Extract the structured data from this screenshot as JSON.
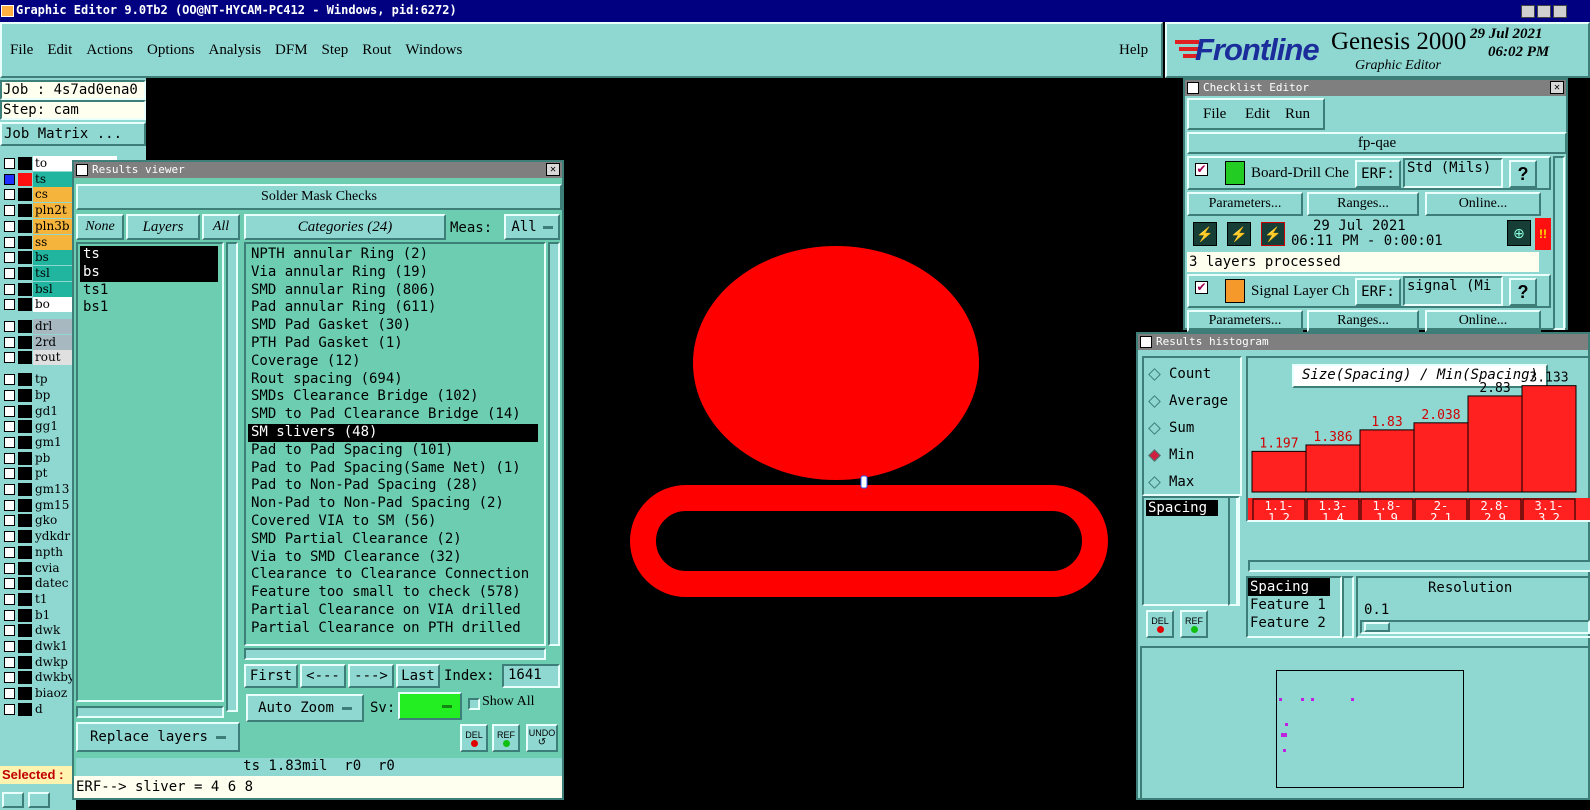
{
  "window_title": "Graphic Editor 9.0Tb2 (OO@NT-HYCAM-PC412 - Windows, pid:6272)",
  "menu": {
    "items": [
      "File",
      "Edit",
      "Actions",
      "Options",
      "Analysis",
      "DFM",
      "Step",
      "Rout",
      "Windows"
    ],
    "help": "Help"
  },
  "brand": {
    "logo": "Frontline",
    "product": "Genesis 2000",
    "subtitle": "Graphic Editor",
    "date": "29 Jul 2021",
    "time": "06:02 PM"
  },
  "job": {
    "job_label": "Job : 4s7ad0ena0",
    "step_label": "Step: cam",
    "matrix_button": "Job Matrix ..."
  },
  "layers": [
    {
      "name": "to",
      "color": "#ffffff"
    },
    {
      "name": "ts",
      "color": "#21b59f"
    },
    {
      "name": "cs",
      "color": "#f5b53c"
    },
    {
      "name": "pln2t",
      "color": "#f5b53c"
    },
    {
      "name": "pln3b",
      "color": "#f5b53c"
    },
    {
      "name": "ss",
      "color": "#f5b53c"
    },
    {
      "name": "bs",
      "color": "#21b59f"
    },
    {
      "name": "tsl",
      "color": "#21b59f"
    },
    {
      "name": "bsl",
      "color": "#21b59f"
    },
    {
      "name": "bo",
      "color": "#ffffff"
    },
    {
      "name": "drl",
      "color": "#a8b8c0"
    },
    {
      "name": "2rd",
      "color": "#a8b8c0"
    },
    {
      "name": "rout",
      "color": "#e0e0e0"
    },
    {
      "name": "tp",
      "color": "#8fd8d2"
    },
    {
      "name": "bp",
      "color": "#8fd8d2"
    },
    {
      "name": "gd1",
      "color": "#8fd8d2"
    },
    {
      "name": "gg1",
      "color": "#8fd8d2"
    },
    {
      "name": "gm1",
      "color": "#8fd8d2"
    },
    {
      "name": "pb",
      "color": "#8fd8d2"
    },
    {
      "name": "pt",
      "color": "#8fd8d2"
    },
    {
      "name": "gm13",
      "color": "#8fd8d2"
    },
    {
      "name": "gm15",
      "color": "#8fd8d2"
    },
    {
      "name": "gko",
      "color": "#8fd8d2"
    },
    {
      "name": "ydkdr",
      "color": "#8fd8d2"
    },
    {
      "name": "npth",
      "color": "#8fd8d2"
    },
    {
      "name": "cvia",
      "color": "#8fd8d2"
    },
    {
      "name": "datec",
      "color": "#8fd8d2"
    },
    {
      "name": "t1",
      "color": "#8fd8d2"
    },
    {
      "name": "b1",
      "color": "#8fd8d2"
    },
    {
      "name": "dwk",
      "color": "#8fd8d2"
    },
    {
      "name": "dwk1",
      "color": "#8fd8d2"
    },
    {
      "name": "dwkp",
      "color": "#8fd8d2"
    },
    {
      "name": "dwkby",
      "color": "#8fd8d2"
    },
    {
      "name": "biaoz",
      "color": "#8fd8d2"
    },
    {
      "name": "d",
      "color": "#8fd8d2"
    }
  ],
  "selected_label": "Selected :",
  "results_viewer": {
    "title": "Results viewer",
    "header": "Solder Mask Checks",
    "none_btn": "None",
    "layers_label": "Layers",
    "all_btn": "All",
    "layer_list": [
      "ts",
      "bs",
      "ts1",
      "bs1"
    ],
    "selected_layers": [
      0,
      1
    ],
    "categories_label": "Categories (24)",
    "meas_label": "Meas:",
    "meas_value": "All",
    "categories": [
      "NPTH annular Ring (2)",
      "Via annular Ring (19)",
      "SMD annular Ring (806)",
      "Pad annular Ring (611)",
      "SMD Pad Gasket (30)",
      "PTH Pad Gasket (1)",
      "Coverage (12)",
      "Rout spacing (694)",
      "SMDs Clearance Bridge (102)",
      "SMD to Pad Clearance Bridge (14)",
      "SM slivers (48)",
      "Pad to Pad Spacing (101)",
      "Pad to Pad Spacing(Same Net) (1)",
      "Pad to Non-Pad Spacing (28)",
      "Non-Pad to Non-Pad Spacing (2)",
      "Covered VIA to SM (56)",
      "SMD Partial Clearance (2)",
      "Via to SMD Clearance (32)",
      "Clearance to Clearance Connection",
      "Feature too small to check (578)",
      "Partial Clearance on VIA drilled",
      "Partial Clearance on PTH drilled"
    ],
    "selected_category": 10,
    "nav": {
      "first": "First",
      "prev": "<---",
      "next": "--->",
      "last": "Last",
      "index_label": "Index:",
      "index_value": "1641"
    },
    "auto_zoom": "Auto Zoom",
    "sv_label": "Sv:",
    "show_all": "Show All",
    "replace_layers": "Replace layers",
    "del": "DEL",
    "ref": "REF",
    "undo": "UNDO",
    "status": "ts 1.83mil  r0  r0",
    "erf": "ERF--> sliver = 4 6 8"
  },
  "checklist": {
    "title": "Checklist Editor",
    "menu": [
      "File",
      "Edit",
      "Run"
    ],
    "name": "fp-qae",
    "check1": {
      "name": "Board-Drill Che",
      "erf_label": "ERF:",
      "erf_value": "Std (Mils)",
      "help": "?"
    },
    "buttons": [
      "Parameters...",
      "Ranges...",
      "Online..."
    ],
    "run_date": "29 Jul 2021",
    "run_time": "06:11 PM - 0:00:01",
    "alert": "!!",
    "message": "3 layers processed",
    "check2": {
      "name": "Signal Layer Ch",
      "erf_label": "ERF:",
      "erf_value": "signal (Mi",
      "help": "?"
    }
  },
  "histogram": {
    "title": "Results histogram",
    "radios": [
      "Count",
      "Average",
      "Sum",
      "Min",
      "Max"
    ],
    "selected_radio": "Min",
    "left_list": [
      "Spacing"
    ],
    "chart_title": "Size(Spacing) / Min(Spacing)",
    "right_list": [
      "Spacing",
      "Feature 1",
      "Feature 2"
    ],
    "resolution_label": "Resolution",
    "resolution_value": "0.1",
    "del": "DEL",
    "ref": "REF"
  },
  "chart_data": {
    "type": "bar",
    "title": "Size(Spacing) / Min(Spacing)",
    "categories": [
      "1.1-1.2",
      "1.3-1.4",
      "1.8-1.9",
      "2-2.1",
      "2.8-2.9",
      "3.1-3.2"
    ],
    "values": [
      1.197,
      1.386,
      1.83,
      2.038,
      2.83,
      3.133
    ],
    "value_labels": [
      "1.197",
      "1.386",
      "1.83",
      "2.038",
      "2.83",
      "3.133"
    ],
    "tick_top": [
      "1.1-",
      "1.3-",
      "1.8-",
      "2-",
      "2.8-",
      "3.1-"
    ],
    "tick_bottom": [
      "1.2",
      "1.4",
      "1.9",
      "2.1",
      "2.9",
      "3.2"
    ],
    "ylim": [
      0,
      3.3
    ],
    "bar_color": "#ff2020",
    "grid": false
  },
  "colors": {
    "feature": "#ff0000",
    "panel": "#8fd8d2",
    "panel_dark": "#6ccdb0",
    "canvas": "#000000",
    "sv_green": "#22ee22"
  }
}
